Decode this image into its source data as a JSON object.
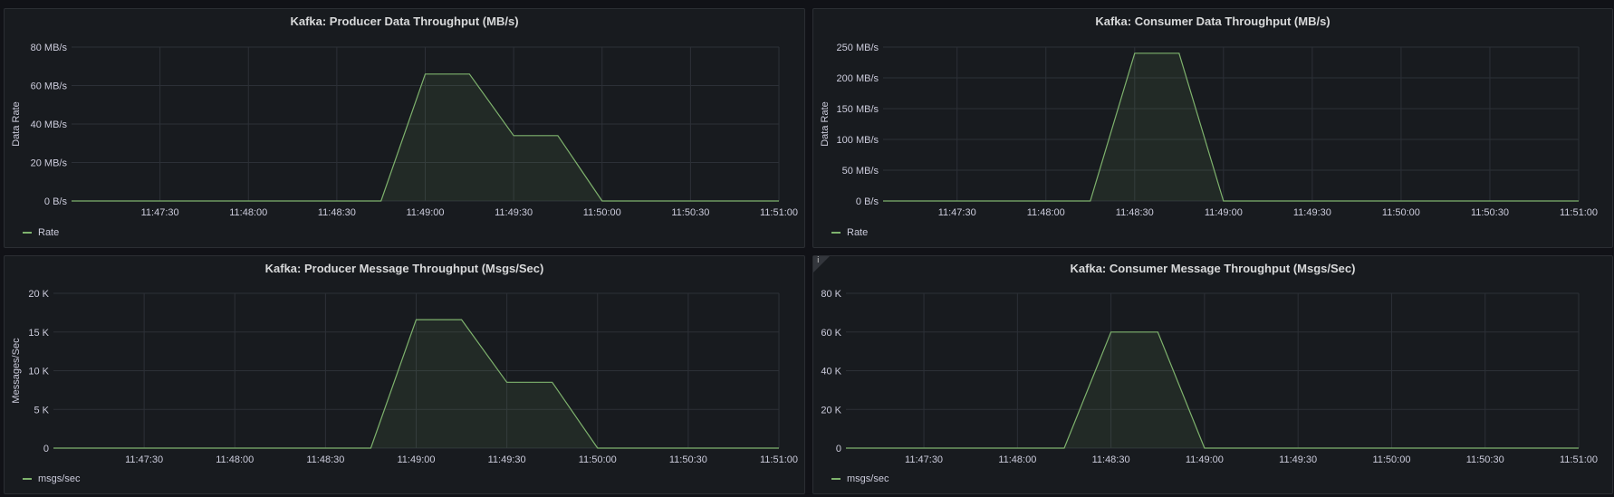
{
  "panels": [
    {
      "title": "Kafka: Producer Data Throughput (MB/s)",
      "info_icon": false,
      "chart_data": {
        "type": "area",
        "title": "Kafka: Producer Data Throughput (MB/s)",
        "ylabel": "Data Rate",
        "xlabel": "",
        "x_range": [
          "11:47:00",
          "11:51:00"
        ],
        "ylim": [
          0,
          80
        ],
        "yticks": [
          0,
          20,
          40,
          60,
          80
        ],
        "ytick_labels": [
          "0 B/s",
          "20 MB/s",
          "40 MB/s",
          "60 MB/s",
          "80 MB/s"
        ],
        "xticks": [
          "11:47:30",
          "11:48:00",
          "11:48:30",
          "11:49:00",
          "11:49:30",
          "11:50:00",
          "11:50:30",
          "11:51:00"
        ],
        "grid": true,
        "legend_position": "bottom-left",
        "color": "#7eb26d",
        "series": [
          {
            "name": "Rate",
            "x": [
              "11:47:00",
              "11:48:45",
              "11:49:00",
              "11:49:15",
              "11:49:30",
              "11:49:45",
              "11:50:00",
              "11:51:00"
            ],
            "values": [
              0,
              0,
              66,
              66,
              34,
              34,
              0,
              0
            ]
          }
        ]
      }
    },
    {
      "title": "Kafka: Consumer Data Throughput (MB/s)",
      "info_icon": false,
      "chart_data": {
        "type": "area",
        "title": "Kafka: Consumer Data Throughput (MB/s)",
        "ylabel": "Data Rate",
        "xlabel": "",
        "x_range": [
          "11:47:05",
          "11:51:00"
        ],
        "ylim": [
          0,
          250
        ],
        "yticks": [
          0,
          50,
          100,
          150,
          200,
          250
        ],
        "ytick_labels": [
          "0 B/s",
          "50 MB/s",
          "100 MB/s",
          "150 MB/s",
          "200 MB/s",
          "250 MB/s"
        ],
        "xticks": [
          "11:47:30",
          "11:48:00",
          "11:48:30",
          "11:49:00",
          "11:49:30",
          "11:50:00",
          "11:50:30",
          "11:51:00"
        ],
        "grid": true,
        "legend_position": "bottom-left",
        "color": "#7eb26d",
        "series": [
          {
            "name": "Rate",
            "x": [
              "11:47:05",
              "11:48:15",
              "11:48:30",
              "11:48:45",
              "11:49:00",
              "11:51:00"
            ],
            "values": [
              0,
              0,
              240,
              240,
              0,
              0
            ]
          }
        ]
      }
    },
    {
      "title": "Kafka: Producer Message Throughput (Msgs/Sec)",
      "info_icon": false,
      "chart_data": {
        "type": "area",
        "title": "Kafka: Producer Message Throughput (Msgs/Sec)",
        "ylabel": "Messages/Sec",
        "xlabel": "",
        "x_range": [
          "11:47:00",
          "11:51:00"
        ],
        "ylim": [
          0,
          20000
        ],
        "yticks": [
          0,
          5000,
          10000,
          15000,
          20000
        ],
        "ytick_labels": [
          "0",
          "5 K",
          "10 K",
          "15 K",
          "20 K"
        ],
        "xticks": [
          "11:47:30",
          "11:48:00",
          "11:48:30",
          "11:49:00",
          "11:49:30",
          "11:50:00",
          "11:50:30",
          "11:51:00"
        ],
        "grid": true,
        "legend_position": "bottom-left",
        "color": "#7eb26d",
        "series": [
          {
            "name": "msgs/sec",
            "x": [
              "11:47:00",
              "11:48:45",
              "11:49:00",
              "11:49:15",
              "11:49:30",
              "11:49:45",
              "11:50:00",
              "11:51:00"
            ],
            "values": [
              0,
              0,
              16600,
              16600,
              8500,
              8500,
              0,
              0
            ]
          }
        ]
      }
    },
    {
      "title": "Kafka: Consumer Message Throughput (Msgs/Sec)",
      "info_icon": true,
      "info_glyph": "i",
      "chart_data": {
        "type": "area",
        "title": "Kafka: Consumer Message Throughput (Msgs/Sec)",
        "ylabel": "",
        "xlabel": "",
        "x_range": [
          "11:47:05",
          "11:51:00"
        ],
        "ylim": [
          0,
          80000
        ],
        "yticks": [
          0,
          20000,
          40000,
          60000,
          80000
        ],
        "ytick_labels": [
          "0",
          "20 K",
          "40 K",
          "60 K",
          "80 K"
        ],
        "xticks": [
          "11:47:30",
          "11:48:00",
          "11:48:30",
          "11:49:00",
          "11:49:30",
          "11:50:00",
          "11:50:30",
          "11:51:00"
        ],
        "grid": true,
        "legend_position": "bottom-left",
        "color": "#7eb26d",
        "series": [
          {
            "name": "msgs/sec",
            "x": [
              "11:47:05",
              "11:48:15",
              "11:48:30",
              "11:48:45",
              "11:49:00",
              "11:51:00"
            ],
            "values": [
              0,
              0,
              60000,
              60000,
              0,
              0
            ]
          }
        ]
      }
    }
  ]
}
